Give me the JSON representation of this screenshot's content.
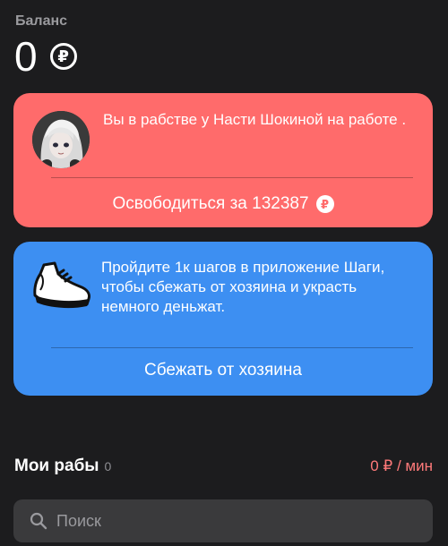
{
  "balance": {
    "label": "Баланс",
    "value": "0",
    "currency_symbol": "₽"
  },
  "owner_card": {
    "color": "#ff6b6b",
    "avatar_icon": "anime-girl-avatar",
    "message": "Вы в рабстве у Насти Шокиной на работе .",
    "free_button_label": "Освободиться за 132387",
    "currency_symbol": "₽"
  },
  "escape_card": {
    "color": "#3d8ff2",
    "icon": "sneaker-icon",
    "message": "Пройдите 1к шагов в приложение Шаги, чтобы сбежать от хозяина и украсть немного деньжат.",
    "escape_button_label": "Сбежать от хозяина"
  },
  "slaves": {
    "title": "Мои рабы",
    "count": "0",
    "income_rate": "0 ₽ / мин",
    "income_color": "#ff7a7a"
  },
  "search": {
    "placeholder": "Поиск",
    "value": ""
  }
}
